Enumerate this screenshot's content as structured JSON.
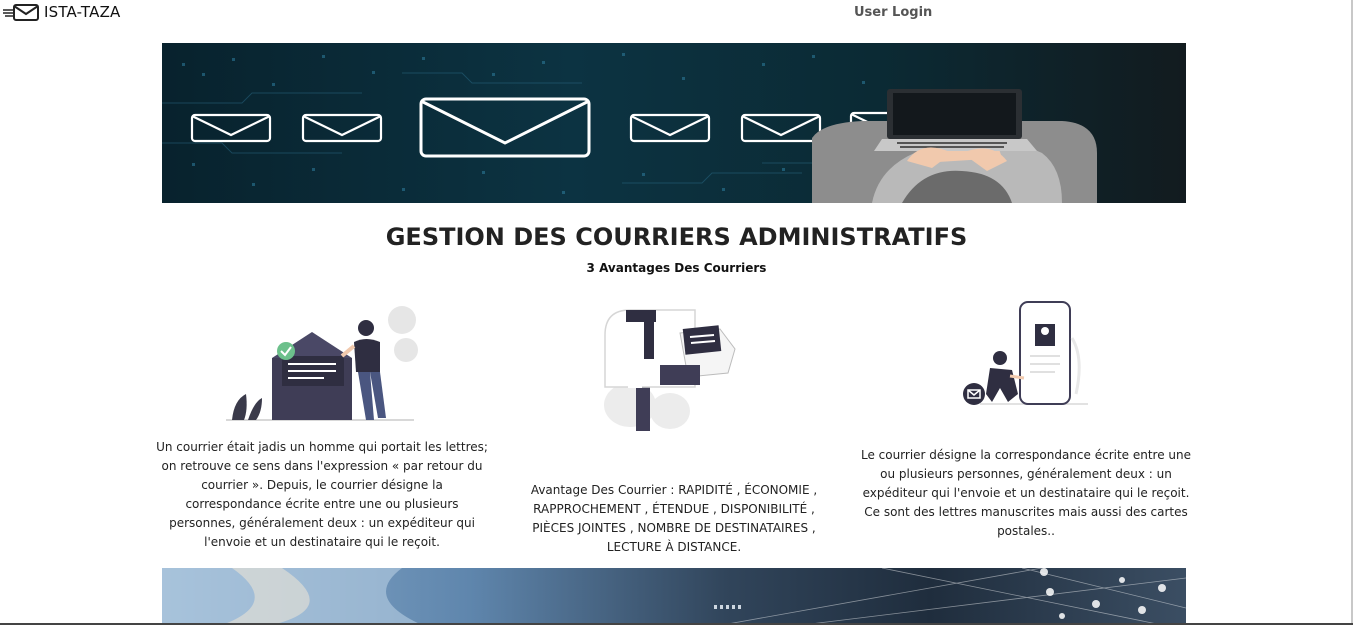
{
  "brand": {
    "icon": "envelope-icon",
    "label": "ISTA-TAZA"
  },
  "nav": {
    "login_label": "User Login"
  },
  "hero": {
    "icon": "envelope-icon"
  },
  "main": {
    "title": "GESTION DES COURRIERS ADMINISTRATIFS",
    "subtitle": "3 Avantages Des Courriers",
    "columns": [
      {
        "text": "Un courrier était jadis un homme qui portait les lettres; on retrouve ce sens dans l'expression « par retour du courrier ». Depuis, le courrier désigne la correspondance écrite entre une ou plusieurs personnes, généralement deux : un expéditeur qui l'envoie et un destinataire qui le reçoit."
      },
      {
        "text": "Avantage Des Courrier : RAPIDITÉ , ÉCONOMIE , RAPPROCHEMENT , ÉTENDUE , DISPONIBILITÉ , PIÈCES JOINTES , NOMBRE DE DESTINATAIRES , LECTURE À DISTANCE."
      },
      {
        "text": "Le courrier désigne la correspondance écrite entre une ou plusieurs personnes, généralement deux : un expéditeur qui l'envoie et un destinataire qui le reçoit. Ce sont des lettres manuscrites mais aussi des cartes postales.."
      }
    ]
  },
  "colors": {
    "hero_bg": "#0c3342",
    "title": "#222222",
    "nav_link": "#555555"
  }
}
